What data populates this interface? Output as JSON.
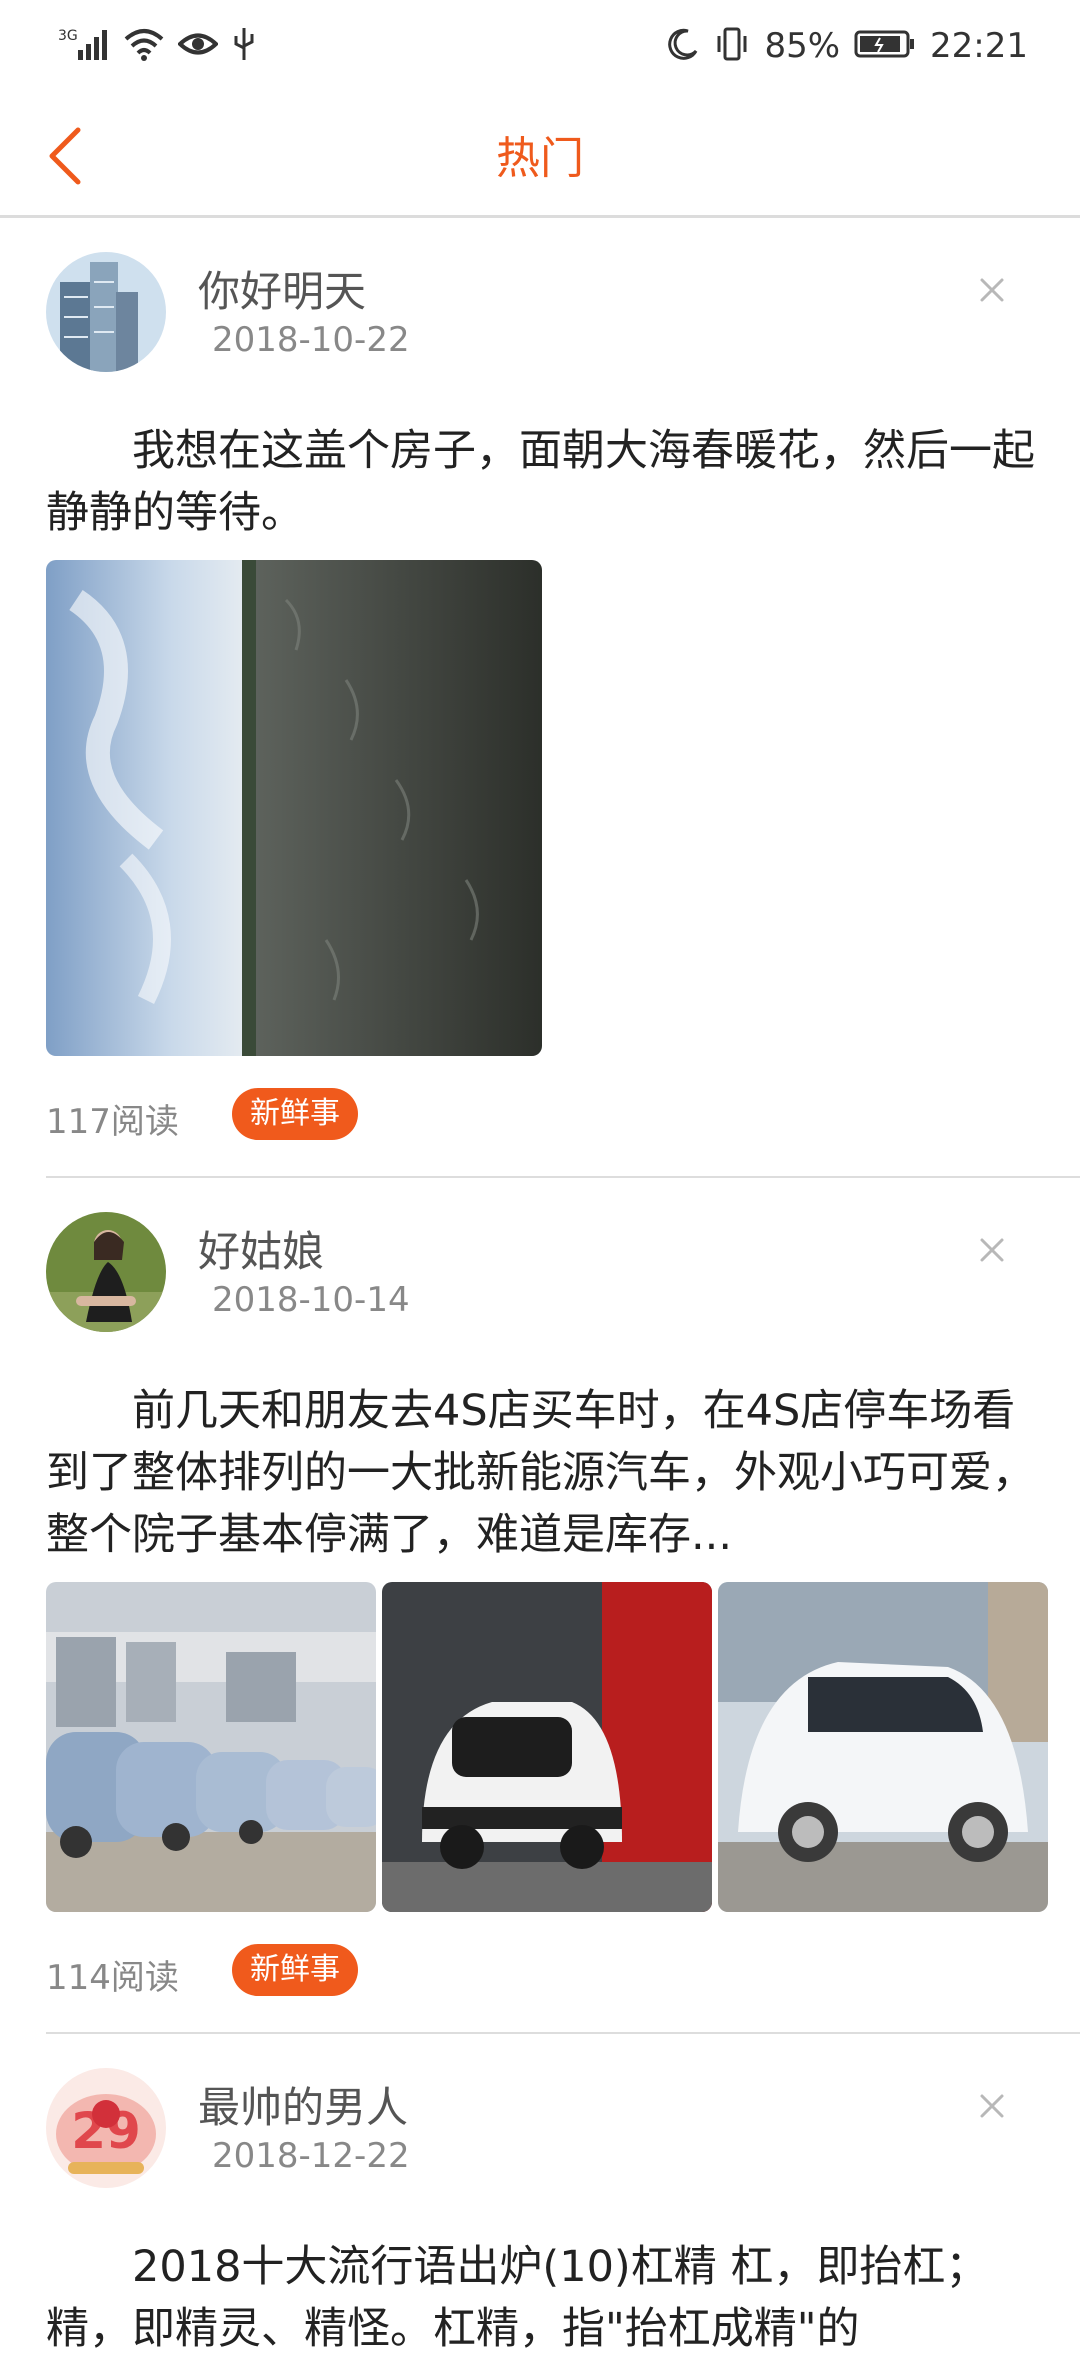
{
  "status_bar": {
    "network": "3G",
    "battery": "85%",
    "time": "22:21"
  },
  "header": {
    "title": "热门"
  },
  "posts": [
    {
      "username": "你好明天",
      "date": "2018-10-22",
      "text": "我想在这盖个房子，面朝大海春暖花，然后一起静静的等待。",
      "reads": "117阅读",
      "tag": "新鲜事"
    },
    {
      "username": "好姑娘",
      "date": "2018-10-14",
      "text": "前几天和朋友去4S店买车时，在4S店停车场看到了整体排列的一大批新能源汽车，外观小巧可爱，整个院子基本停满了，难道是库存...",
      "reads": "114阅读",
      "tag": "新鲜事"
    },
    {
      "username": "最帅的男人",
      "date": "2018-12-22",
      "text": "2018十大流行语出炉(10)杠精 杠，即抬杠；精，即精灵、精怪。杠精，指\"抬杠成精\"的"
    }
  ],
  "colors": {
    "accent": "#ef5a1c",
    "tag_bg": "#f05a1c"
  }
}
